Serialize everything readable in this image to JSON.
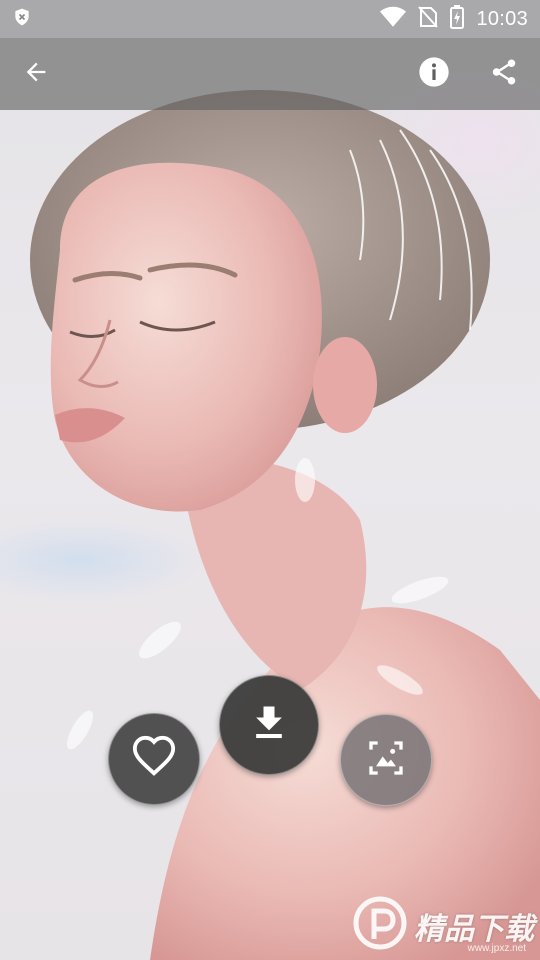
{
  "status_bar": {
    "time": "10:03",
    "icons": [
      "shield-icon",
      "wifi-icon",
      "no-sim-icon",
      "battery-charging-icon"
    ]
  },
  "app_bar": {
    "back_icon": "arrow-back-icon",
    "info_icon": "info-icon",
    "share_icon": "share-icon"
  },
  "actions": {
    "favorite_icon": "heart-outline-icon",
    "download_icon": "download-icon",
    "set_wallpaper_icon": "wallpaper-icon"
  },
  "watermark": {
    "brand": "精品下载",
    "url": "www.jpxz.net"
  },
  "colors": {
    "appbar": "#5f5f5f",
    "fab": "#3a3a3a",
    "icon": "#ffffff"
  }
}
